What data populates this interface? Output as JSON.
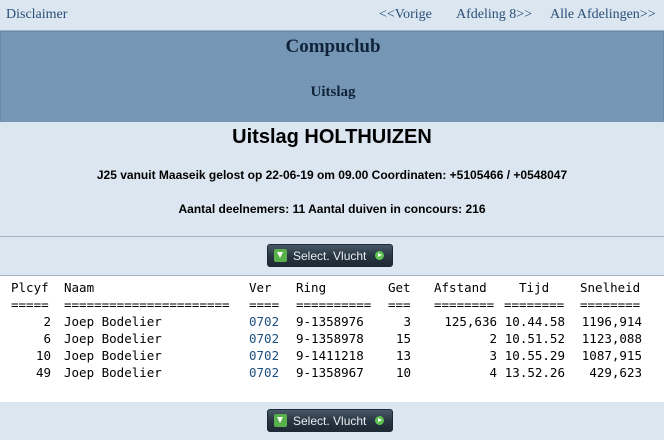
{
  "nav": {
    "disclaimer": "Disclaimer",
    "prev": "<<Vorige",
    "afdeling": "Afdeling 8>>",
    "all": "Alle Afdelingen>>"
  },
  "banner": {
    "club": "Compuclub",
    "subtitle": "Uitslag"
  },
  "race": {
    "title": "Uitslag HOLTHUIZEN",
    "line1": "J25 vanuit Maaseik gelost op 22-06-19 om 09.00 Coordinaten: +5105466 / +0548047",
    "line2": "Aantal deelnemers: 11 Aantal duiven in concours: 216"
  },
  "button": {
    "label": "Select. Vlucht"
  },
  "table": {
    "headers": [
      "Plcyf",
      "Naam",
      "Ver",
      "Ring",
      "Get",
      "Afstand",
      "Tijd",
      "Snelheid"
    ],
    "separators": [
      "=====",
      "======================",
      "====",
      "==========",
      "===",
      "========",
      "========",
      "========"
    ],
    "rows": [
      [
        "2",
        "Joep Bodelier",
        "0702",
        "9-1358976",
        "3",
        "125,636",
        "10.44.58",
        "1196,914"
      ],
      [
        "6",
        "Joep Bodelier",
        "0702",
        "9-1358978",
        "15",
        "2",
        "10.51.52",
        "1123,088"
      ],
      [
        "10",
        "Joep Bodelier",
        "0702",
        "9-1411218",
        "13",
        "3",
        "10.55.29",
        "1087,915"
      ],
      [
        "49",
        "Joep Bodelier",
        "0702",
        "9-1358967",
        "10",
        "4",
        "13.52.26",
        "429,623"
      ]
    ]
  }
}
